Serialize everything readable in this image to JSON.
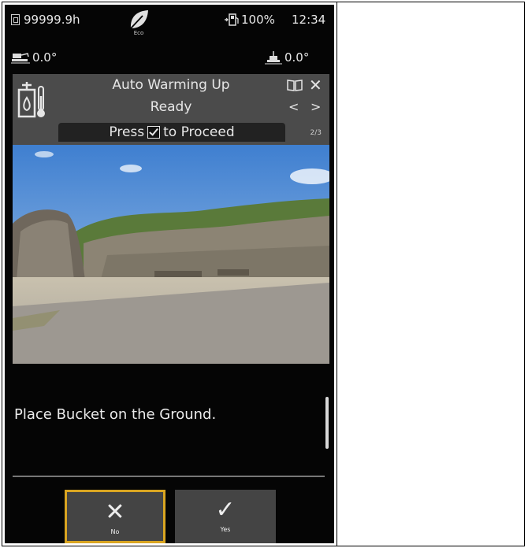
{
  "status": {
    "hour_meter": "99999.9h",
    "eco_label": "Eco",
    "fuel": "100%",
    "clock": "12:34"
  },
  "angles": {
    "left": "0.0°",
    "right": "0.0°"
  },
  "header": {
    "title_line1": "Auto Warming Up",
    "title_line2": "Ready",
    "press_prefix": "Press",
    "press_suffix": "to Proceed",
    "page_indicator": "2/3",
    "prev_glyph": "<",
    "next_glyph": ">"
  },
  "message": "Place Bucket on the Ground.",
  "buttons": {
    "no_label": "No",
    "yes_label": "Yes"
  },
  "colors": {
    "screen_bg": "#050505",
    "header_bg": "#4b4b4b",
    "selected_border": "#d9a521",
    "button_bg": "#444444"
  }
}
